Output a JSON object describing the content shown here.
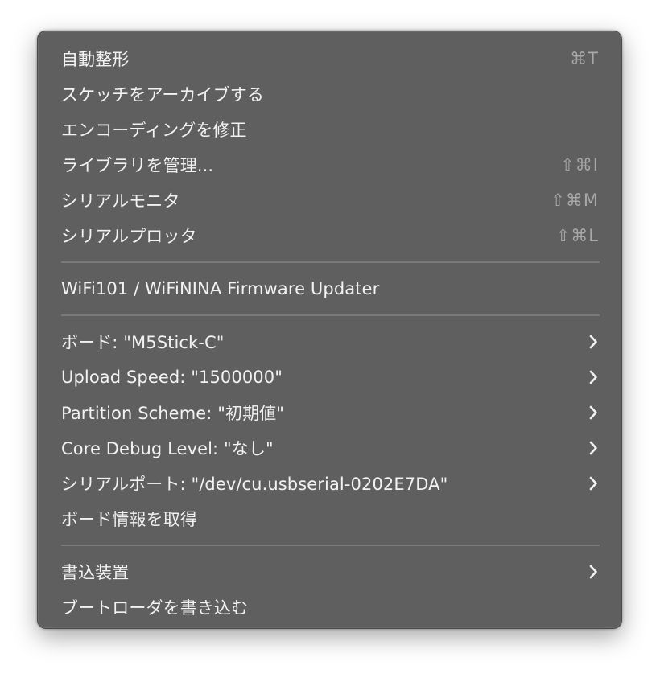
{
  "menu": {
    "group1": [
      {
        "label": "自動整形",
        "shortcut": "⌘T"
      },
      {
        "label": "スケッチをアーカイブする",
        "shortcut": ""
      },
      {
        "label": "エンコーディングを修正",
        "shortcut": ""
      },
      {
        "label": "ライブラリを管理...",
        "shortcut": "⇧⌘I"
      },
      {
        "label": "シリアルモニタ",
        "shortcut": "⇧⌘M"
      },
      {
        "label": "シリアルプロッタ",
        "shortcut": "⇧⌘L"
      }
    ],
    "group2": [
      {
        "label": "WiFi101 / WiFiNINA Firmware Updater"
      }
    ],
    "group3": [
      {
        "label": "ボード: \"M5Stick-C\"",
        "submenu": true
      },
      {
        "label": "Upload Speed: \"1500000\"",
        "submenu": true
      },
      {
        "label": "Partition Scheme: \"初期値\"",
        "submenu": true
      },
      {
        "label": "Core Debug Level: \"なし\"",
        "submenu": true
      },
      {
        "label": "シリアルポート: \"/dev/cu.usbserial-0202E7DA\"",
        "submenu": true
      },
      {
        "label": "ボード情報を取得",
        "submenu": false
      }
    ],
    "group4": [
      {
        "label": "書込装置",
        "submenu": true
      },
      {
        "label": "ブートローダを書き込む",
        "submenu": false
      }
    ]
  },
  "icons": {
    "submenu": "chevron-right-icon"
  },
  "colors": {
    "menu_background": "#5f5f5f",
    "text": "#f2f2f2",
    "shortcut_text": "#a8a8a8",
    "separator": "#7a7a7a"
  }
}
